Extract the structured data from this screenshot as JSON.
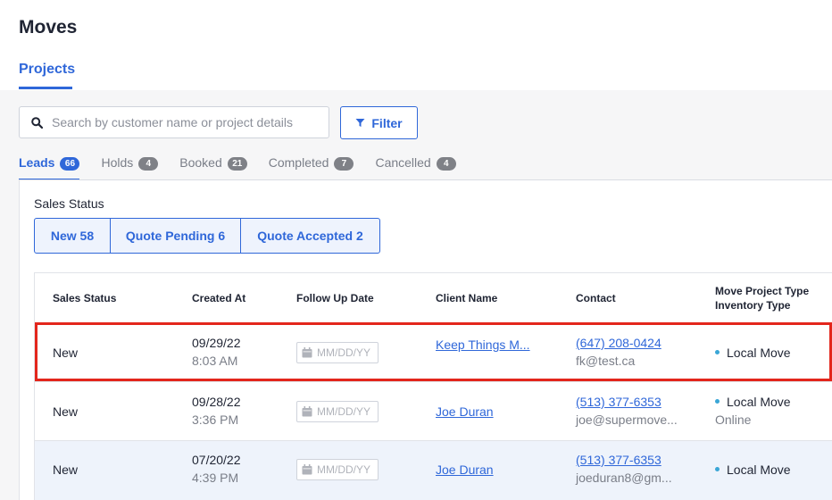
{
  "header": {
    "title": "Moves",
    "active_tab": "Projects"
  },
  "search": {
    "placeholder": "Search by customer name or project details",
    "value": ""
  },
  "filter": {
    "label": "Filter"
  },
  "status_tabs": [
    {
      "label": "Leads",
      "count": "66",
      "active": true
    },
    {
      "label": "Holds",
      "count": "4",
      "active": false
    },
    {
      "label": "Booked",
      "count": "21",
      "active": false
    },
    {
      "label": "Completed",
      "count": "7",
      "active": false
    },
    {
      "label": "Cancelled",
      "count": "4",
      "active": false
    }
  ],
  "sales_status": {
    "label": "Sales Status",
    "segments": [
      {
        "label": "New 58"
      },
      {
        "label": "Quote Pending 6"
      },
      {
        "label": "Quote Accepted 2"
      }
    ]
  },
  "table": {
    "columns": {
      "sales_status": "Sales Status",
      "created_at": "Created At",
      "follow_up": "Follow Up Date",
      "client_name": "Client Name",
      "contact": "Contact",
      "move_type_line1": "Move Project Type",
      "move_type_line2": "Inventory Type"
    },
    "date_placeholder": "MM/DD/YY",
    "rows": [
      {
        "status": "New",
        "date": "09/29/22",
        "time": "8:03 AM",
        "client": "Keep Things M...",
        "phone": "(647) 208-0424",
        "email": "fk@test.ca",
        "move_type": "Local Move",
        "inventory": ""
      },
      {
        "status": "New",
        "date": "09/28/22",
        "time": "3:36 PM",
        "client": "Joe Duran",
        "phone": "(513) 377-6353",
        "email": "joe@supermove...",
        "move_type": "Local Move",
        "inventory": "Online"
      },
      {
        "status": "New",
        "date": "07/20/22",
        "time": "4:39 PM",
        "client": "Joe Duran",
        "phone": "(513) 377-6353",
        "email": "joeduran8@gm...",
        "move_type": "Local Move",
        "inventory": ""
      }
    ]
  },
  "colors": {
    "accent": "#2f67d9",
    "highlight": "#e3261c",
    "selected_row": "#eef3fb"
  }
}
